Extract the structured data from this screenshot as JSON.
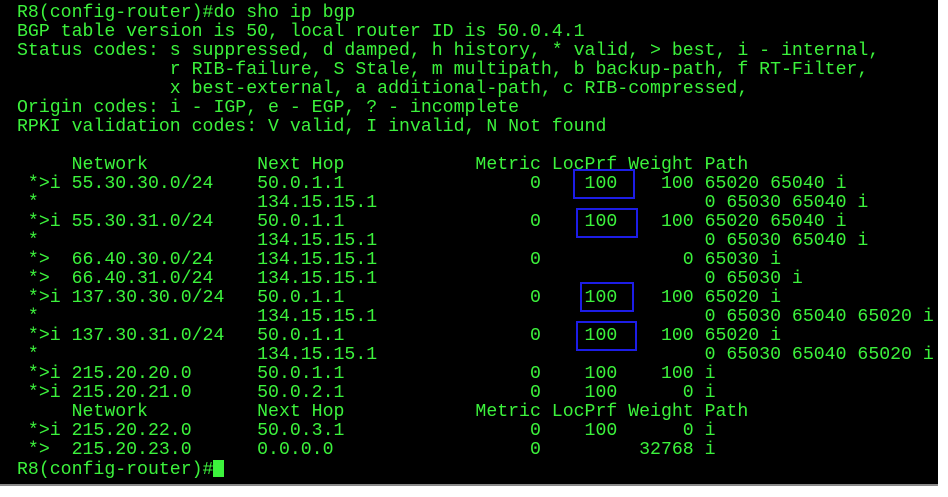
{
  "terminal": {
    "lines": [
      "R8(config-router)#do sho ip bgp",
      "BGP table version is 50, local router ID is 50.0.4.1",
      "Status codes: s suppressed, d damped, h history, * valid, > best, i - internal,",
      "              r RIB-failure, S Stale, m multipath, b backup-path, f RT-Filter,",
      "              x best-external, a additional-path, c RIB-compressed,",
      "Origin codes: i - IGP, e - EGP, ? - incomplete",
      "RPKI validation codes: V valid, I invalid, N Not found",
      "",
      "     Network          Next Hop            Metric LocPrf Weight Path",
      " *>i 55.30.30.0/24    50.0.1.1                 0    100    100 65020 65040 i",
      " *                    134.15.15.1                              0 65030 65040 i",
      " *>i 55.30.31.0/24    50.0.1.1                 0    100    100 65020 65040 i",
      " *                    134.15.15.1                              0 65030 65040 i",
      " *>  66.40.30.0/24    134.15.15.1              0             0 65030 i",
      " *>  66.40.31.0/24    134.15.15.1                              0 65030 i",
      " *>i 137.30.30.0/24   50.0.1.1                 0    100    100 65020 i",
      " *                    134.15.15.1                              0 65030 65040 65020 i",
      " *>i 137.30.31.0/24   50.0.1.1                 0    100    100 65020 i",
      " *                    134.15.15.1                              0 65030 65040 65020 i",
      " *>i 215.20.20.0      50.0.1.1                 0    100    100 i",
      " *>i 215.20.21.0      50.0.2.1                 0    100      0 i",
      "     Network          Next Hop            Metric LocPrf Weight Path",
      " *>i 215.20.22.0      50.0.3.1                 0    100      0 i",
      " *>  215.20.23.0      0.0.0.0                  0         32768 i"
    ],
    "prompt": "R8(config-router)#"
  },
  "colors": {
    "background": "#000000",
    "text": "#3cf23c",
    "highlight_box": "#1d1de6"
  }
}
